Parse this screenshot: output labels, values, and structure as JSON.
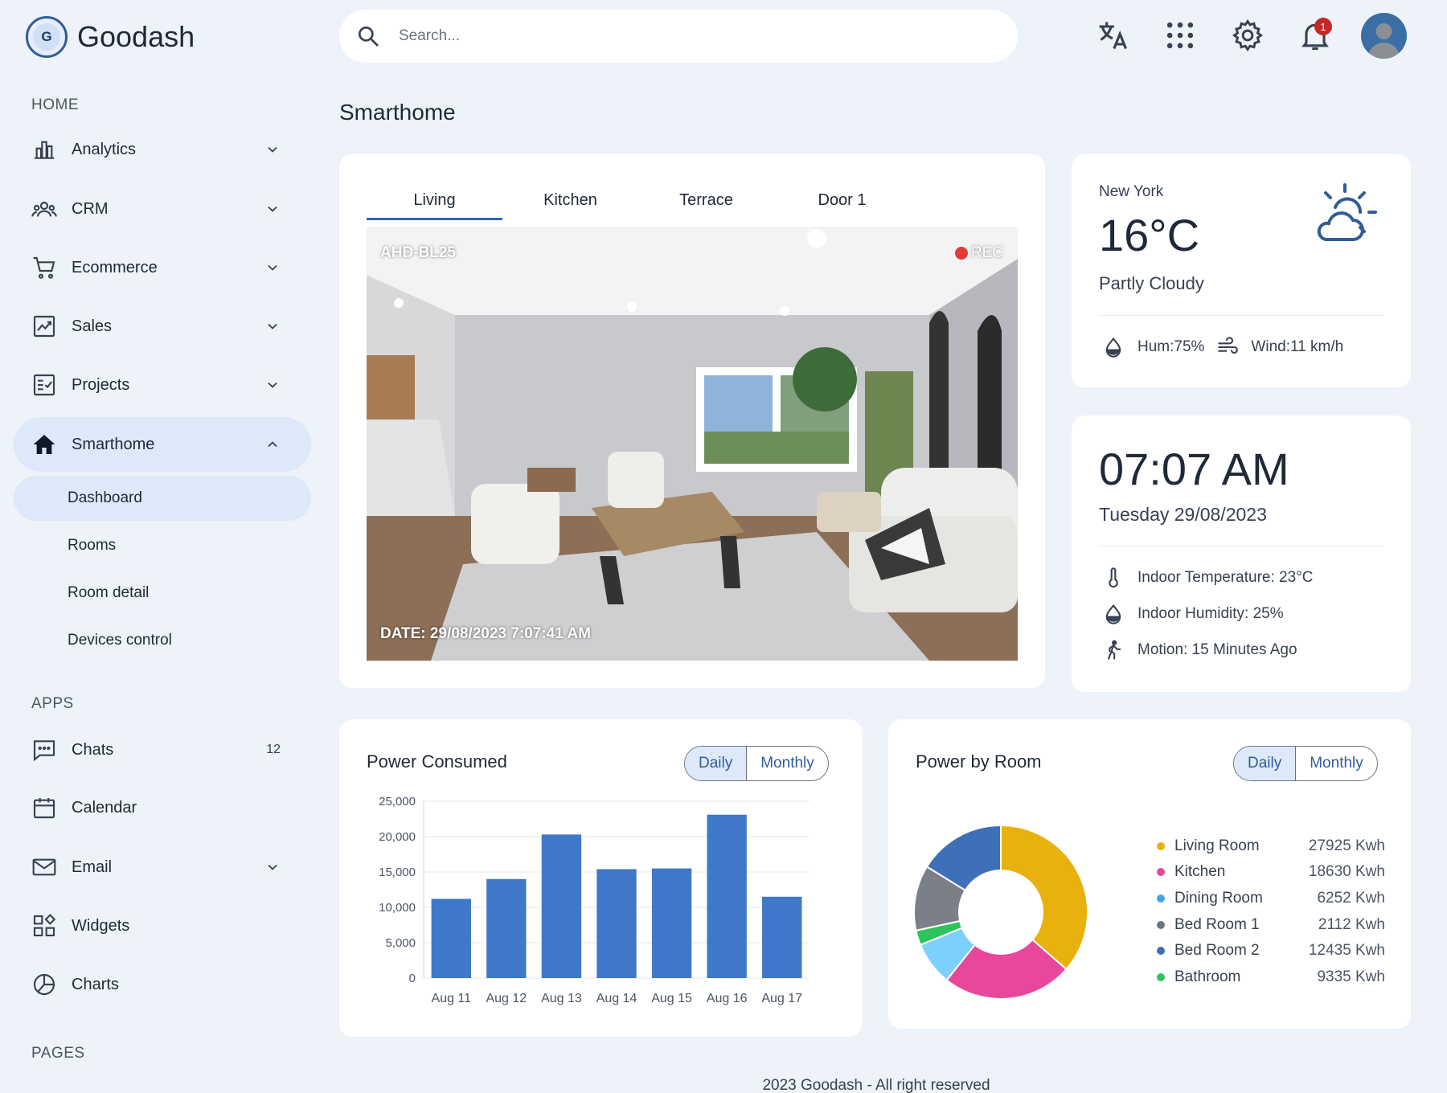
{
  "brand": {
    "logo_letter": "G",
    "name": "Goodash"
  },
  "sidebar": {
    "home_label": "HOME",
    "items": [
      {
        "label": "Analytics"
      },
      {
        "label": "CRM"
      },
      {
        "label": "Ecommerce"
      },
      {
        "label": "Sales"
      },
      {
        "label": "Projects"
      },
      {
        "label": "Smarthome"
      }
    ],
    "sub_items": [
      {
        "label": "Dashboard"
      },
      {
        "label": "Rooms"
      },
      {
        "label": "Room detail"
      },
      {
        "label": "Devices control"
      }
    ],
    "apps_label": "APPS",
    "apps": [
      {
        "label": "Chats",
        "count": "12"
      },
      {
        "label": "Calendar"
      },
      {
        "label": "Email"
      },
      {
        "label": "Widgets"
      },
      {
        "label": "Charts"
      }
    ],
    "pages_label": "PAGES"
  },
  "header": {
    "search_placeholder": "Search...",
    "notification_count": "1"
  },
  "page_title": "Smarthome",
  "camera": {
    "tabs": [
      "Living",
      "Kitchen",
      "Terrace",
      "Door 1"
    ],
    "camera_id": "AHD-BL25",
    "rec_label": "REC",
    "date_label": "DATE:  29/08/2023  7:07:41 AM"
  },
  "weather": {
    "city": "New York",
    "temperature": "16°C",
    "condition": "Partly Cloudy",
    "humidity": "Hum:75%",
    "wind": "Wind:11 km/h"
  },
  "clock": {
    "time": "07:07 AM",
    "date": "Tuesday 29/08/2023",
    "indoor_temperature": "Indoor Temperature: 23°C",
    "indoor_humidity": "Indoor Humidity: 25%",
    "motion": "Motion: 15 Minutes Ago"
  },
  "power_consumed": {
    "title": "Power Consumed",
    "toggle": [
      "Daily",
      "Monthly"
    ]
  },
  "power_by_room": {
    "title": "Power by Room",
    "toggle": [
      "Daily",
      "Monthly"
    ]
  },
  "colors": {
    "accent": "#2f5d99",
    "bar": "#3f78c8"
  },
  "chart_data": [
    {
      "type": "bar",
      "categories": [
        "Aug 11",
        "Aug 12",
        "Aug 13",
        "Aug 14",
        "Aug 15",
        "Aug 16",
        "Aug 17"
      ],
      "values": [
        11200,
        14000,
        20300,
        15400,
        15500,
        23100,
        11500
      ],
      "ylim": [
        0,
        25000
      ],
      "yticks": [
        "25,000",
        "20,000",
        "15,000",
        "10,000",
        "5,000",
        "0"
      ],
      "grid": true
    },
    {
      "type": "pie",
      "categories": [
        "Living Room",
        "Kitchen",
        "Dining Room",
        "Bed Room 1",
        "Bed Room 2",
        "Bathroom"
      ],
      "labels": [
        "27925 Kwh",
        "18630 Kwh",
        "6252 Kwh",
        "2112 Kwh",
        "12435 Kwh",
        "9335 Kwh"
      ],
      "legend_colors": [
        "#e8b10d",
        "#e8479b",
        "#43a5e6",
        "#6b7280",
        "#3f6fb6",
        "#2ec45b"
      ],
      "slices": [
        {
          "value": 27925,
          "color": "#e8b10d"
        },
        {
          "value": 18630,
          "color": "#e8479b"
        },
        {
          "value": 6252,
          "color": "#7dd0fb"
        },
        {
          "value": 2112,
          "color": "#2ec45b"
        },
        {
          "value": 9335,
          "color": "#7b7f88"
        },
        {
          "value": 12435,
          "color": "#3f6fb6"
        }
      ],
      "donut": true,
      "legend": "right"
    }
  ],
  "footer": "2023 Goodash - All right reserved"
}
